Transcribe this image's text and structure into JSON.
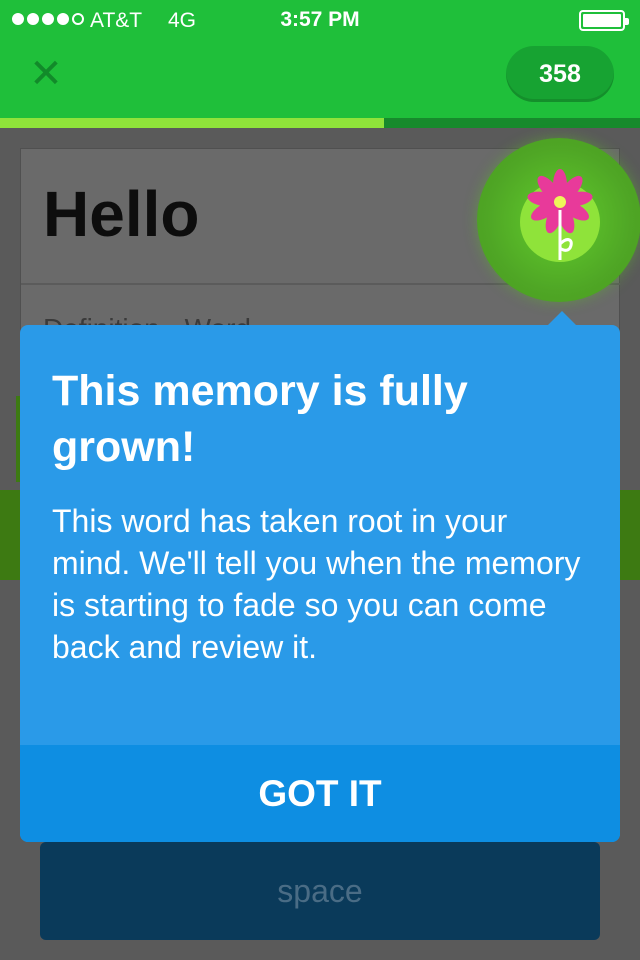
{
  "status_bar": {
    "carrier": "AT&T",
    "network": "4G",
    "time": "3:57 PM"
  },
  "header": {
    "close_symbol": "✕",
    "score": "358",
    "progress_fraction": 0.6
  },
  "word_card": {
    "title": "Hello",
    "definition_label": "Definition · Word"
  },
  "answer_button": {
    "label": "space"
  },
  "modal": {
    "title": "This memory is fully grown!",
    "body": "This word has taken root in your mind. We'll tell you when the memory is starting to fade so you can come back and review it.",
    "action_label": "GOT IT"
  },
  "colors": {
    "header_green": "#1fbf3a",
    "progress_green": "#8fe33a",
    "modal_blue": "#2a9ae8",
    "modal_action_blue": "#0e8ee2",
    "flower_pink": "#e83a9a"
  },
  "icons": {
    "close": "close-icon",
    "flower": "flower-icon",
    "battery": "battery-icon",
    "signal": "signal-icon"
  }
}
